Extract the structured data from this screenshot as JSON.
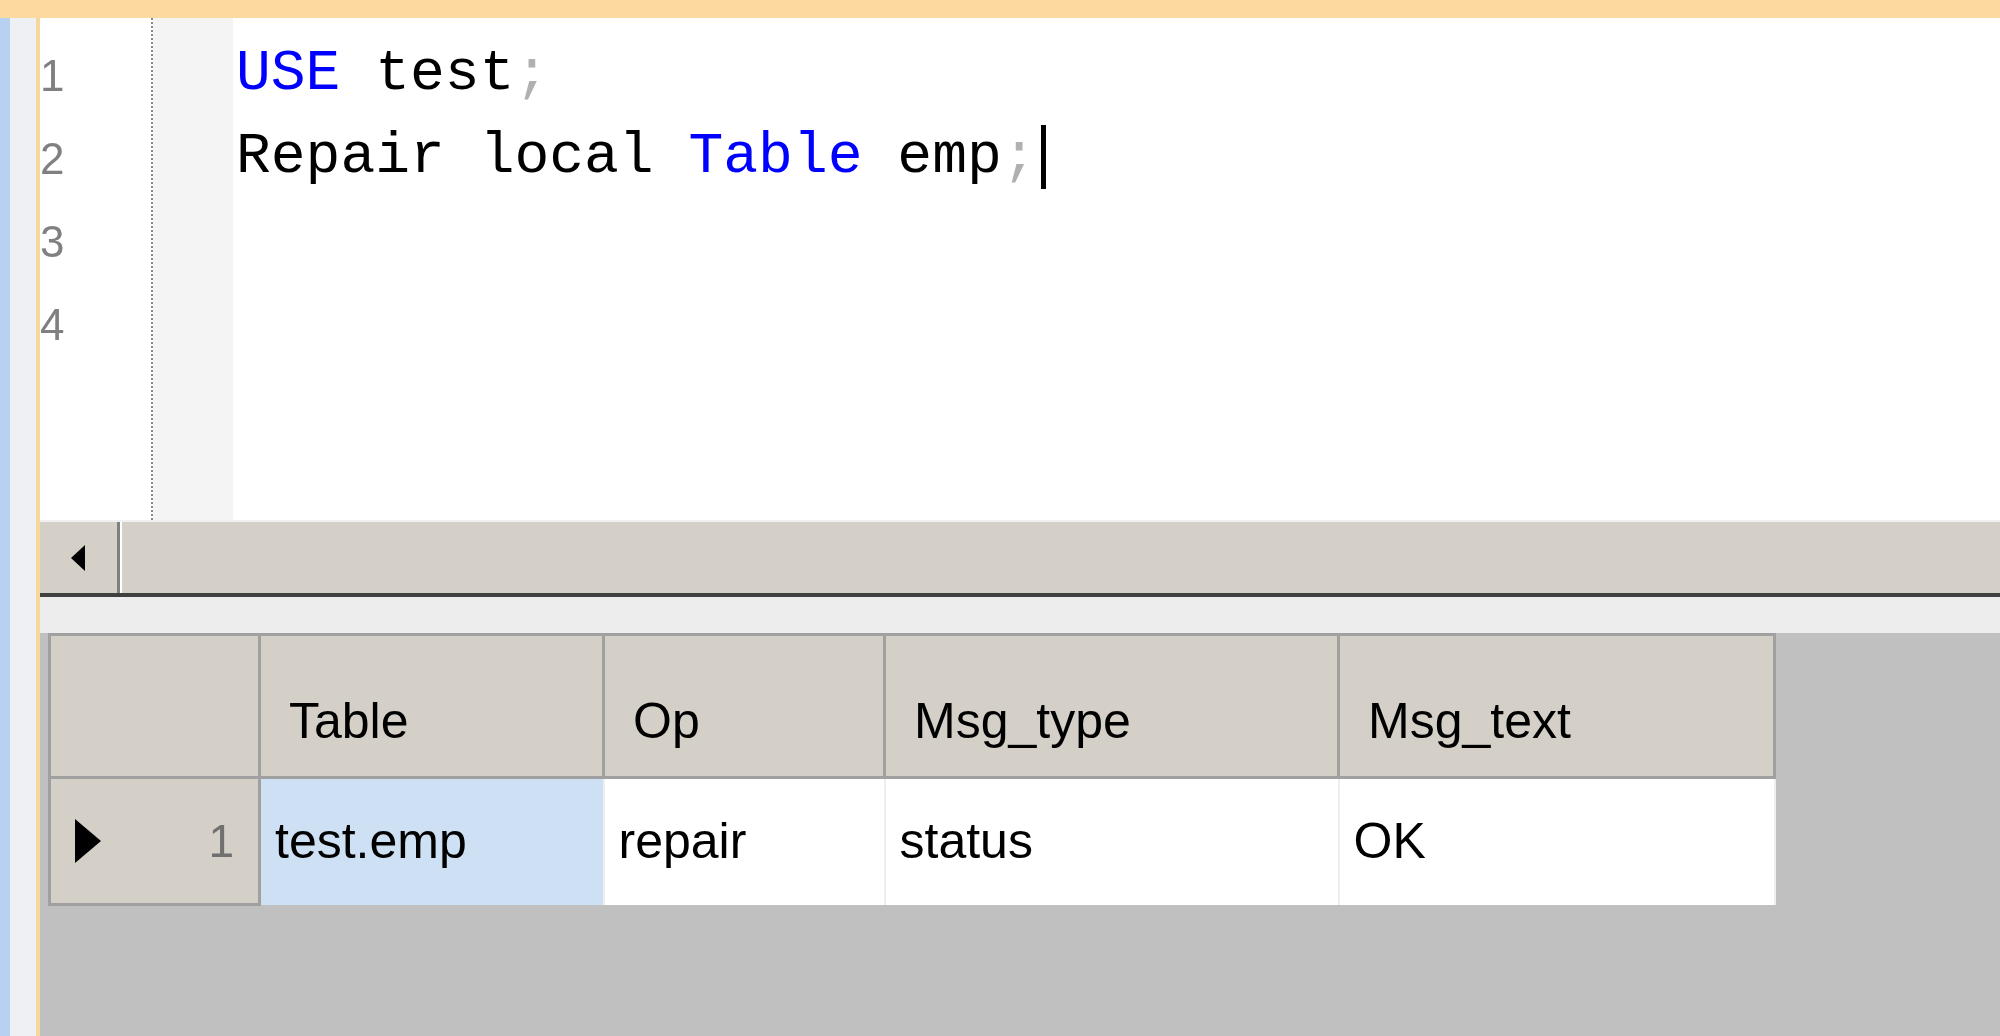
{
  "editor": {
    "lines": [
      {
        "number": "1",
        "cursor": false,
        "tokens": [
          {
            "text": "USE",
            "kind": "keyword"
          },
          {
            "text": " test",
            "kind": "plain"
          },
          {
            "text": ";",
            "kind": "punct"
          }
        ]
      },
      {
        "number": "2",
        "cursor": true,
        "tokens": [
          {
            "text": "Repair local ",
            "kind": "plain"
          },
          {
            "text": "Table",
            "kind": "keyword"
          },
          {
            "text": " emp",
            "kind": "plain"
          },
          {
            "text": ";",
            "kind": "punct"
          }
        ]
      },
      {
        "number": "3",
        "cursor": false
      },
      {
        "number": "4",
        "cursor": false
      }
    ]
  },
  "results": {
    "columns": [
      "Table",
      "Op",
      "Msg_type",
      "Msg_text"
    ],
    "rows": [
      {
        "number": "1",
        "current": true,
        "cells": [
          {
            "text": "test.emp",
            "selected": true
          },
          {
            "text": "repair",
            "selected": false
          },
          {
            "text": "status",
            "selected": false
          },
          {
            "text": "OK",
            "selected": false
          }
        ]
      }
    ]
  }
}
